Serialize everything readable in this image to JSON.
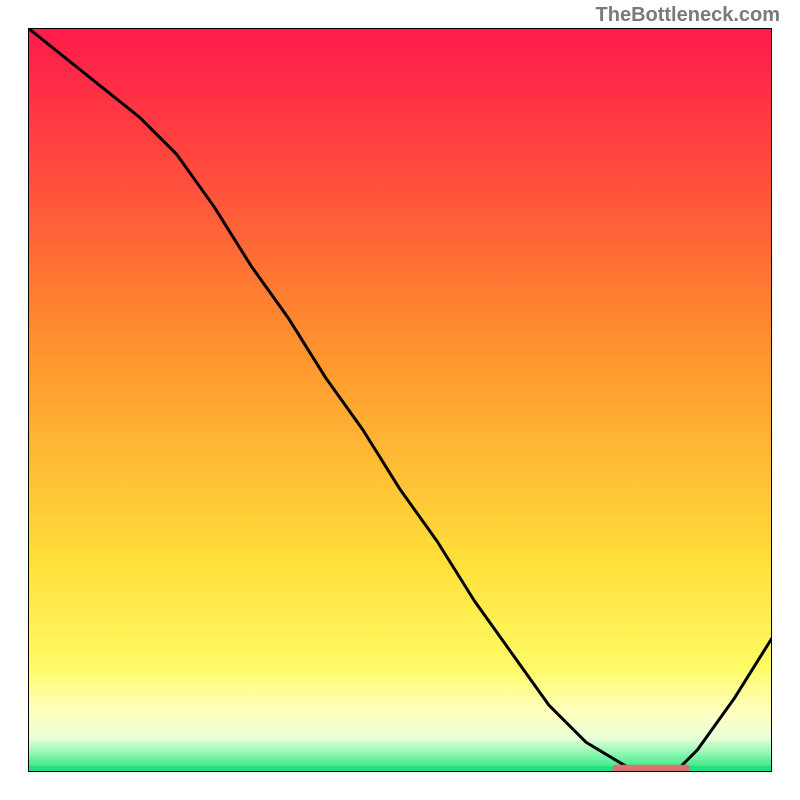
{
  "watermark": "TheBottleneck.com",
  "chart_data": {
    "type": "line",
    "title": "",
    "xlabel": "",
    "ylabel": "",
    "xlim": [
      0,
      100
    ],
    "ylim": [
      0,
      100
    ],
    "series": [
      {
        "name": "bottleneck-curve",
        "x": [
          0,
          5,
          10,
          15,
          20,
          25,
          30,
          35,
          40,
          45,
          50,
          55,
          60,
          65,
          70,
          75,
          80,
          82,
          85,
          87,
          90,
          95,
          100
        ],
        "values": [
          100,
          96,
          92,
          88,
          83,
          76,
          68,
          61,
          53,
          46,
          38,
          31,
          23,
          16,
          9,
          4,
          1,
          0,
          0,
          0,
          3,
          10,
          18
        ]
      },
      {
        "name": "optimal-band",
        "x": [
          79,
          88.5
        ],
        "values": [
          0.5,
          0.5
        ]
      }
    ],
    "gradient_stops": [
      {
        "offset": 0.0,
        "color": "#ff1a4b"
      },
      {
        "offset": 0.2,
        "color": "#ff4d3d"
      },
      {
        "offset": 0.4,
        "color": "#ff8a2e"
      },
      {
        "offset": 0.55,
        "color": "#ffb333"
      },
      {
        "offset": 0.72,
        "color": "#ffe03a"
      },
      {
        "offset": 0.86,
        "color": "#fffb66"
      },
      {
        "offset": 0.92,
        "color": "#ffffc0"
      },
      {
        "offset": 0.955,
        "color": "#e8ffd8"
      },
      {
        "offset": 0.975,
        "color": "#8df7b2"
      },
      {
        "offset": 1.0,
        "color": "#22e27a"
      }
    ],
    "colors": {
      "curve": "#000000",
      "optimal_band": "#d9726a",
      "frame": "#000000"
    }
  }
}
